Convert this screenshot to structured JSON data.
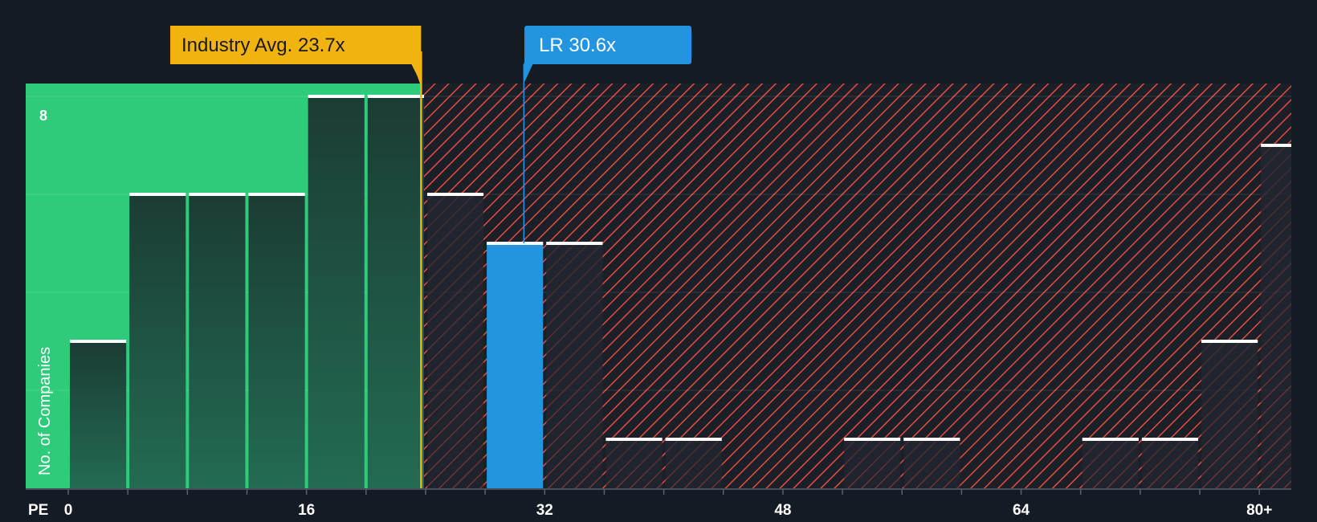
{
  "colors": {
    "background": "#151b24",
    "fair_zone": "#2ecc7a",
    "expensive_hatch": "#e74c3c",
    "bar_fill": "#1f3d36",
    "bar_top": "#ffffff",
    "industry_marker": "#f1b310",
    "company_marker": "#2394df",
    "axis_text": "#ffffff"
  },
  "chart_data": {
    "type": "bar",
    "title": "",
    "xlabel": "PE",
    "ylabel": "No. of Companies",
    "xlim": [
      0,
      82
    ],
    "ylim": [
      0,
      8.25
    ],
    "x_ticks": [
      {
        "value": 0,
        "label": "0"
      },
      {
        "value": 16,
        "label": "16"
      },
      {
        "value": 32,
        "label": "32"
      },
      {
        "value": 48,
        "label": "48"
      },
      {
        "value": 64,
        "label": "64"
      },
      {
        "value": 80,
        "label": "80+"
      }
    ],
    "y_tick_label": {
      "value": 8,
      "label": "8"
    },
    "y_gridlines": [
      2,
      4,
      6,
      8
    ],
    "bin_width": 4,
    "bins": [
      {
        "x0": 0,
        "x1": 4,
        "count": 3
      },
      {
        "x0": 4,
        "x1": 8,
        "count": 6
      },
      {
        "x0": 8,
        "x1": 12,
        "count": 6
      },
      {
        "x0": 12,
        "x1": 16,
        "count": 6
      },
      {
        "x0": 16,
        "x1": 20,
        "count": 8
      },
      {
        "x0": 20,
        "x1": 24,
        "count": 8
      },
      {
        "x0": 24,
        "x1": 28,
        "count": 6
      },
      {
        "x0": 28,
        "x1": 32,
        "count": 5,
        "highlight": true
      },
      {
        "x0": 32,
        "x1": 36,
        "count": 5
      },
      {
        "x0": 36,
        "x1": 40,
        "count": 1
      },
      {
        "x0": 40,
        "x1": 44,
        "count": 1
      },
      {
        "x0": 44,
        "x1": 48,
        "count": 0
      },
      {
        "x0": 48,
        "x1": 52,
        "count": 0
      },
      {
        "x0": 52,
        "x1": 56,
        "count": 1
      },
      {
        "x0": 56,
        "x1": 60,
        "count": 1
      },
      {
        "x0": 60,
        "x1": 64,
        "count": 0
      },
      {
        "x0": 64,
        "x1": 68,
        "count": 0
      },
      {
        "x0": 68,
        "x1": 72,
        "count": 1
      },
      {
        "x0": 72,
        "x1": 76,
        "count": 1
      },
      {
        "x0": 76,
        "x1": 80,
        "count": 3
      },
      {
        "x0": 80,
        "x1": 84,
        "count": 7
      }
    ],
    "fair_zone_end": 23.7,
    "industry_avg": {
      "value": 23.7,
      "label": "Industry Avg. 23.7x"
    },
    "company": {
      "value": 30.6,
      "label": "LR 30.6x"
    }
  }
}
